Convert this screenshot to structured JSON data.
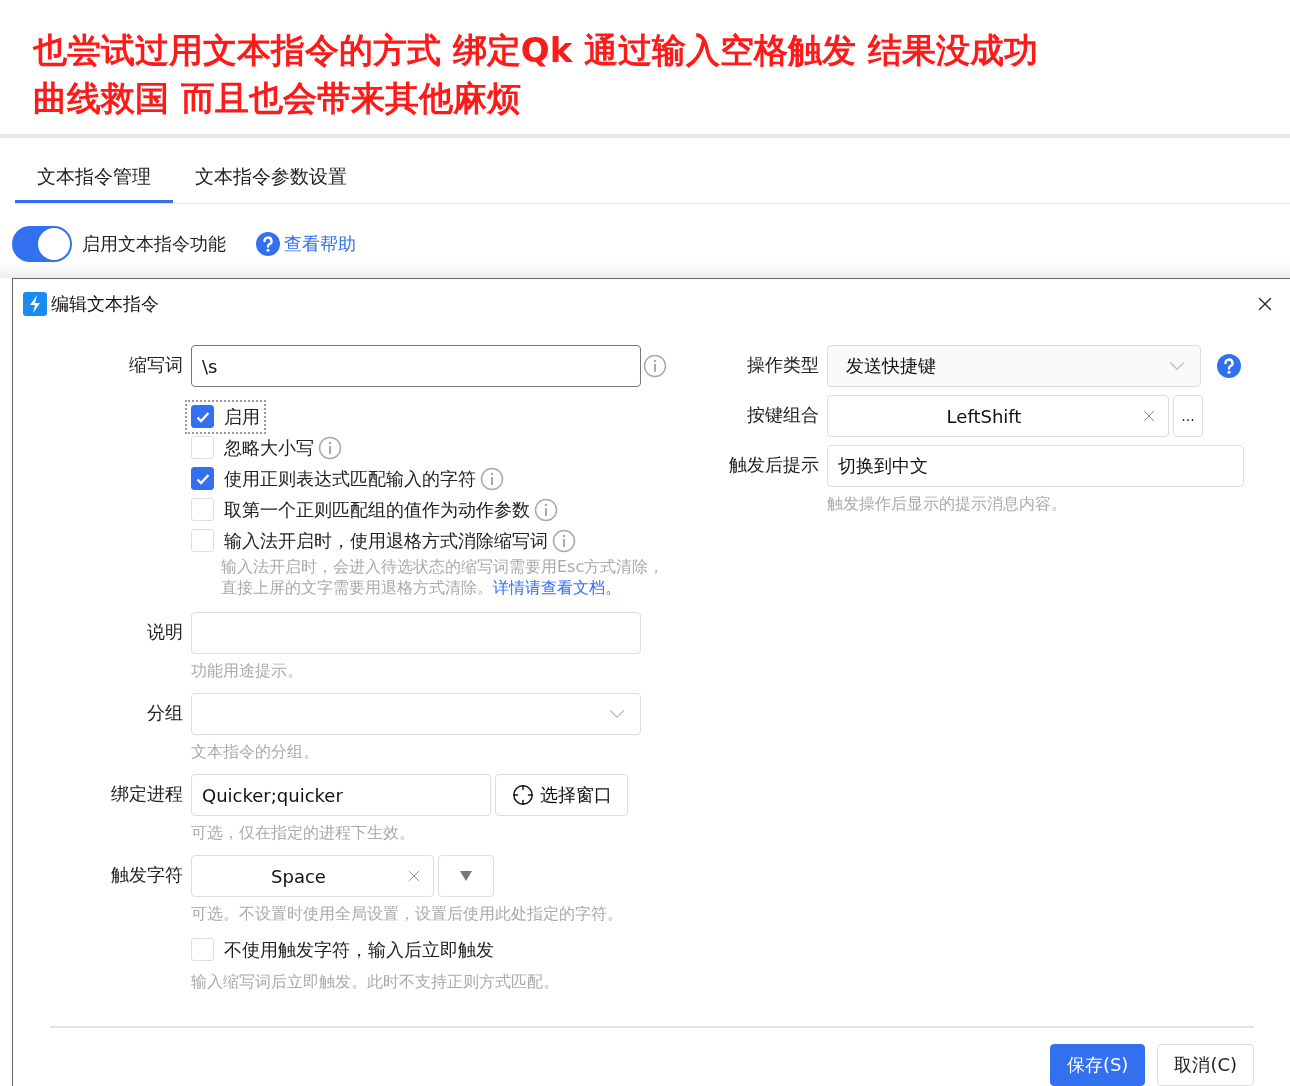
{
  "annotation": [
    "也尝试过用文本指令的方式 绑定Qk 通过输入空格触发 结果没成功",
    "曲线救国 而且也会带来其他麻烦"
  ],
  "tabs": [
    {
      "label": "文本指令管理",
      "selected": true
    },
    {
      "label": "文本指令参数设置",
      "selected": false
    }
  ],
  "feature_toggle": {
    "label": "启用文本指令功能",
    "on": true
  },
  "help_link": "查看帮助",
  "dialog": {
    "title": "编辑文本指令",
    "abbreviation": {
      "label": "缩写词",
      "value": "\\s"
    },
    "options": [
      {
        "label": "启用",
        "checked": true,
        "focused": true,
        "info": false
      },
      {
        "label": "忽略大小写",
        "checked": false,
        "focused": false,
        "info": true
      },
      {
        "label": "使用正则表达式匹配输入的字符",
        "checked": true,
        "focused": false,
        "info": true
      },
      {
        "label": "取第一个正则匹配组的值作为动作参数",
        "checked": false,
        "focused": false,
        "info": true
      },
      {
        "label": "输入法开启时，使用退格方式消除缩写词",
        "checked": false,
        "focused": false,
        "info": true
      }
    ],
    "options_hint": "输入法开启时，会进入待选状态的缩写词需要用Esc方式清除，直接上屏的文字需要用退格方式清除。",
    "options_hint_link": "详情请查看文档。",
    "description": {
      "label": "说明",
      "hint": "功能用途提示。"
    },
    "group": {
      "label": "分组",
      "hint": "文本指令的分组。"
    },
    "process": {
      "label": "绑定进程",
      "value": "Quicker;quicker",
      "button": "选择窗口",
      "hint": "可选，仅在指定的进程下生效。"
    },
    "trigger_char": {
      "label": "触发字符",
      "value": "Space",
      "hint": "可选。不设置时使用全局设置，设置后使用此处指定的字符。"
    },
    "no_trigger": {
      "label": "不使用触发字符，输入后立即触发",
      "checked": false,
      "hint": "输入缩写词后立即触发。此时不支持正则方式匹配。"
    },
    "action_type": {
      "label": "操作类型",
      "value": "发送快捷键"
    },
    "hotkey": {
      "label": "按键组合",
      "value": "LeftShift",
      "button": "..."
    },
    "tip": {
      "label": "触发后提示",
      "value": "切换到中文",
      "hint": "触发操作后显示的提示消息内容。"
    },
    "buttons": [
      {
        "label": "保存(S)",
        "kind": "primary"
      },
      {
        "label": "取消(C)",
        "kind": "default"
      }
    ]
  }
}
